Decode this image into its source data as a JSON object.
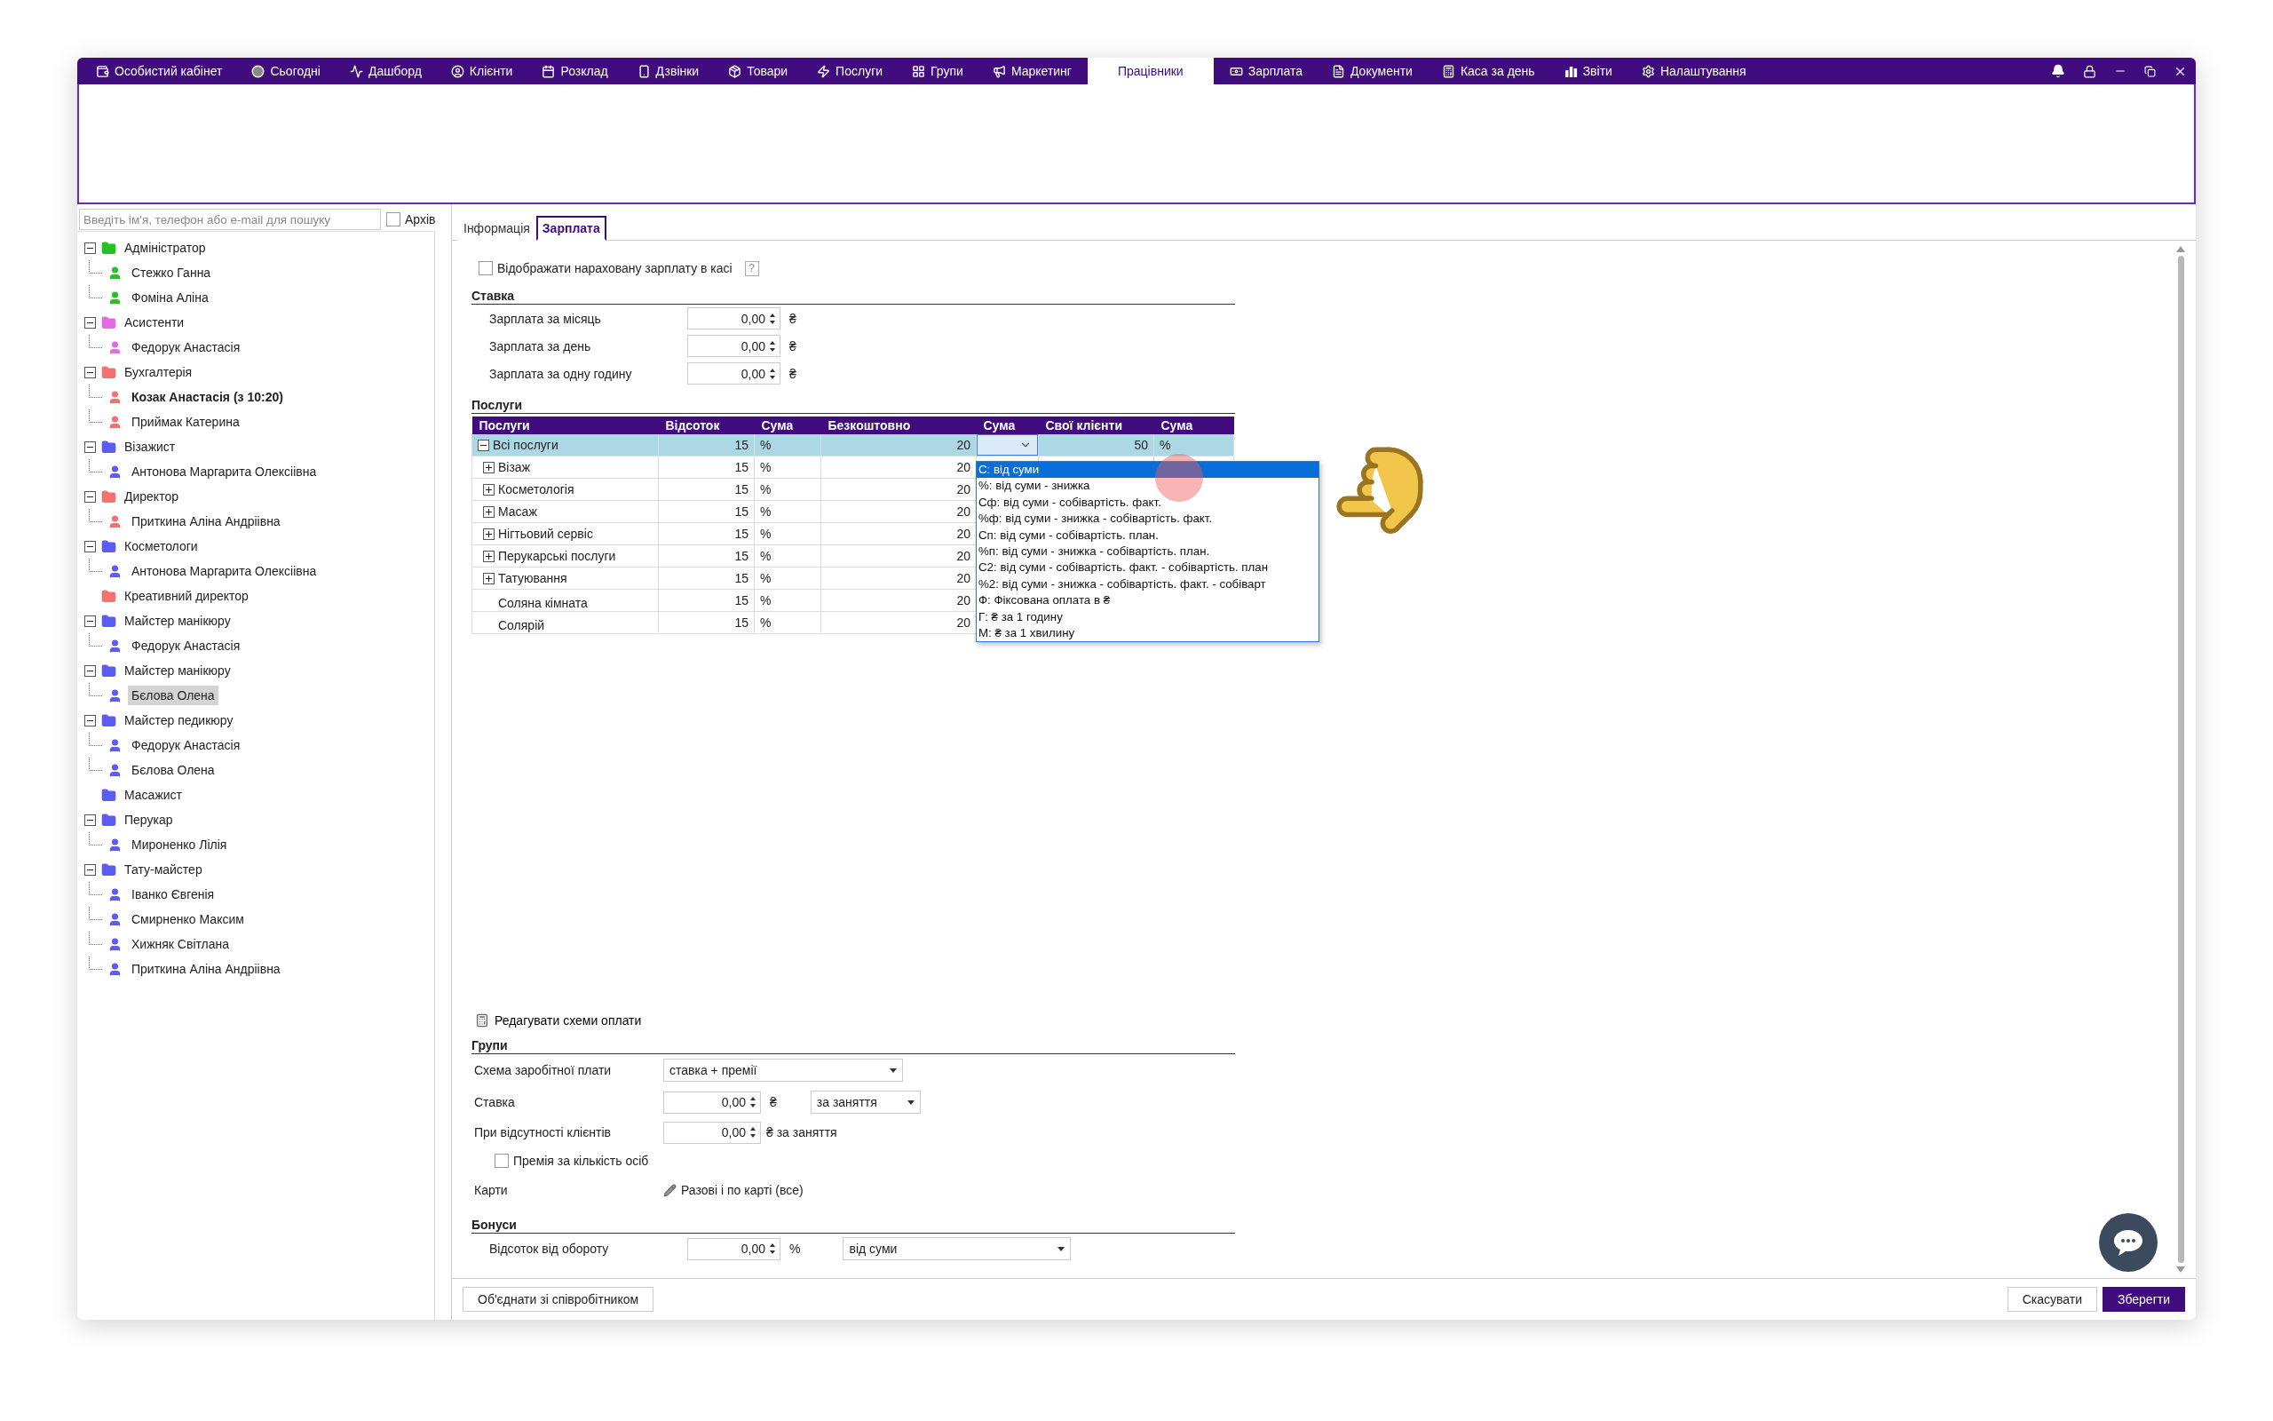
{
  "menu": [
    {
      "label": "Особистий кабінет",
      "selected": false
    },
    {
      "label": "Сьогодні",
      "selected": false
    },
    {
      "label": "Дашборд",
      "selected": false
    },
    {
      "label": "Клієнти",
      "selected": false
    },
    {
      "label": "Розклад",
      "selected": false
    },
    {
      "label": "Дзвінки",
      "selected": false
    },
    {
      "label": "Товари",
      "selected": false
    },
    {
      "label": "Послуги",
      "selected": false
    },
    {
      "label": "Групи",
      "selected": false
    },
    {
      "label": "Маркетинг",
      "selected": false
    },
    {
      "label": "Працівники",
      "selected": true
    },
    {
      "label": "Зарплата",
      "selected": false
    },
    {
      "label": "Документи",
      "selected": false
    },
    {
      "label": "Каса за день",
      "selected": false
    },
    {
      "label": "Звіти",
      "selected": false
    },
    {
      "label": "Налаштування",
      "selected": false
    }
  ],
  "search": {
    "placeholder": "Введіть ім'я, телефон або e-mail для пошуку"
  },
  "archive": {
    "label": "Архів",
    "checked": false
  },
  "staff_tree": [
    {
      "label": "Адміністратор",
      "color": "#22c322",
      "children": [
        {
          "label": "Стежко Ганна",
          "bold": false,
          "selected": false
        },
        {
          "label": "Фоміна Аліна",
          "bold": false,
          "selected": false
        }
      ]
    },
    {
      "label": "Асистенти",
      "color": "#e56be5",
      "children": [
        {
          "label": "Федорук Анастасія",
          "bold": false,
          "selected": false
        }
      ]
    },
    {
      "label": "Бухгалтерія",
      "color": "#f77070",
      "children": [
        {
          "label": "Козак Анастасія (з 10:20)",
          "bold": true,
          "selected": false
        },
        {
          "label": "Приймак Катерина",
          "bold": false,
          "selected": false
        }
      ]
    },
    {
      "label": "Візажист",
      "color": "#5b5bf5",
      "children": [
        {
          "label": "Антонова Маргарита Олексіівна",
          "bold": false,
          "selected": false
        }
      ]
    },
    {
      "label": "Директор",
      "color": "#f77070",
      "children": [
        {
          "label": "Приткина Аліна Андріівна",
          "bold": false,
          "selected": false
        }
      ]
    },
    {
      "label": "Косметологи",
      "color": "#5b5bf5",
      "children": [
        {
          "label": "Антонова Маргарита Олексіівна",
          "bold": false,
          "selected": false
        }
      ]
    },
    {
      "label": "Креативний директор",
      "color": "#f77070"
    },
    {
      "label": "Майстер манікюру",
      "color": "#5b5bf5",
      "children": [
        {
          "label": "Федорук Анастасія",
          "bold": false,
          "selected": false
        }
      ]
    },
    {
      "label": "Майстер манікюру",
      "color": "#5b5bf5",
      "children": [
        {
          "label": "Бєлова Олена",
          "bold": false,
          "selected": true
        }
      ]
    },
    {
      "label": "Майстер педикюру",
      "color": "#5b5bf5",
      "children": [
        {
          "label": "Федорук Анастасія",
          "bold": false,
          "selected": false
        },
        {
          "label": "Бєлова Олена",
          "bold": false,
          "selected": false
        }
      ]
    },
    {
      "label": "Масажист",
      "color": "#5b5bf5"
    },
    {
      "label": "Перукар",
      "color": "#5b5bf5",
      "children": [
        {
          "label": "Мироненко Лілія",
          "bold": false,
          "selected": false
        }
      ]
    },
    {
      "label": "Тату-майстер",
      "color": "#5b5bf5",
      "children": [
        {
          "label": "Іванко Євгенія",
          "bold": false,
          "selected": false
        },
        {
          "label": "Смирненко Максим",
          "bold": false,
          "selected": false
        },
        {
          "label": "Хижняк Світлана",
          "bold": false,
          "selected": false
        },
        {
          "label": "Приткина Аліна Андріівна",
          "bold": false,
          "selected": false
        }
      ]
    }
  ],
  "tabs": [
    {
      "label": "Інформація",
      "selected": false
    },
    {
      "label": "Зарплата",
      "selected": true
    }
  ],
  "show_in_cashbox": {
    "label": "Відображати нараховану зарплату в касі",
    "checked": false,
    "help": "?"
  },
  "rate": {
    "title": "Ставка",
    "rows": [
      {
        "label": "Зарплата за місяць",
        "value": "0,00",
        "unit": "₴"
      },
      {
        "label": "Зарплата за день",
        "value": "0,00",
        "unit": "₴"
      },
      {
        "label": "Зарплата за одну годину",
        "value": "0,00",
        "unit": "₴"
      }
    ]
  },
  "services": {
    "title": "Послуги",
    "columns": [
      "Послуги",
      "Відсоток",
      "Сума",
      "Безкоштовно",
      "Сума",
      "Свої клієнти",
      "Сума"
    ],
    "rows": [
      {
        "name": "Всі послуги",
        "kind": "expanded",
        "selected": true,
        "percent": "15",
        "unit": "%",
        "free": "20",
        "own_clients": "50",
        "own_unit": "%"
      },
      {
        "name": "Візаж",
        "kind": "collapsed",
        "selected": false,
        "percent": "15",
        "unit": "%",
        "free": "20"
      },
      {
        "name": "Косметологія",
        "kind": "collapsed",
        "selected": false,
        "percent": "15",
        "unit": "%",
        "free": "20"
      },
      {
        "name": "Масаж",
        "kind": "collapsed",
        "selected": false,
        "percent": "15",
        "unit": "%",
        "free": "20"
      },
      {
        "name": "Нігтьовий сервіс",
        "kind": "collapsed",
        "selected": false,
        "percent": "15",
        "unit": "%",
        "free": "20"
      },
      {
        "name": "Перукарські послуги",
        "kind": "collapsed",
        "selected": false,
        "percent": "15",
        "unit": "%",
        "free": "20"
      },
      {
        "name": "Татуювання",
        "kind": "collapsed",
        "selected": false,
        "percent": "15",
        "unit": "%",
        "free": "20"
      },
      {
        "name": "Соляна кімната",
        "kind": "leaf",
        "selected": false,
        "percent": "15",
        "unit": "%",
        "free": "20"
      },
      {
        "name": "Солярій",
        "kind": "leaf",
        "selected": false,
        "percent": "15",
        "unit": "%",
        "free": "20"
      }
    ]
  },
  "dropdown": {
    "options": [
      {
        "label": "С: від суми",
        "selected": true
      },
      {
        "label": "%: від суми - знижка",
        "selected": false
      },
      {
        "label": "Сф: від суми - собівартість. факт.",
        "selected": false
      },
      {
        "label": "%ф: від суми - знижка - собівартість. факт.",
        "selected": false
      },
      {
        "label": "Сп: від суми - собівартість. план.",
        "selected": false
      },
      {
        "label": "%п: від суми - знижка - собівартість. план.",
        "selected": false
      },
      {
        "label": "С2: від суми - собівартість. факт. - собівартість. план",
        "selected": false
      },
      {
        "label": "%2: від суми - знижка - собівартість. факт. - собіварт",
        "selected": false
      },
      {
        "label": "Ф: Фіксована оплата в ₴",
        "selected": false
      },
      {
        "label": "Г: ₴ за 1 годину",
        "selected": false
      },
      {
        "label": "М: ₴ за 1 хвилину",
        "selected": false
      }
    ]
  },
  "edit_schemes": {
    "label": "Редагувати схеми оплати"
  },
  "groups": {
    "title": "Групи",
    "scheme": {
      "label": "Схема заробітної плати",
      "value": "ставка + премії"
    },
    "rate": {
      "label": "Ставка",
      "value": "0,00",
      "unit": "₴",
      "period": "за заняття"
    },
    "no_clients": {
      "label": "При відсутності клієнтів",
      "value": "0,00",
      "unit": "₴ за заняття"
    },
    "bonus_per_person": {
      "label": "Премія за кількість осіб",
      "checked": false
    },
    "cards": {
      "label": "Карти",
      "value": "Разові і по карті (все)"
    }
  },
  "bonuses": {
    "title": "Бонуси",
    "turnover": {
      "label": "Відсоток від обороту",
      "value": "0,00",
      "unit": "%",
      "basis": "від суми"
    }
  },
  "footer": {
    "merge": "Об'єднати зі співробітником",
    "cancel": "Скасувати",
    "save": "Зберегти"
  }
}
